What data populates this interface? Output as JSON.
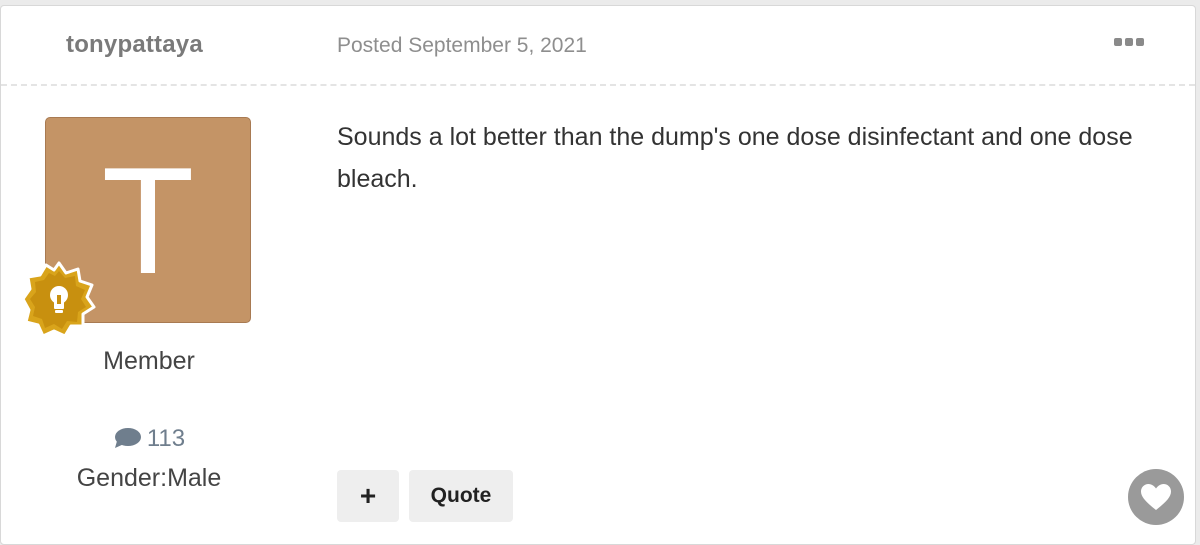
{
  "post": {
    "author": "tonypattaya",
    "posted": "Posted September 5, 2021",
    "avatar_letter": "T",
    "role": "Member",
    "post_count": "113",
    "gender": "Gender:Male",
    "content": "Sounds a lot better than the dump's one dose disinfectant and one dose bleach.",
    "actions": {
      "plus_label": "+",
      "quote_label": "Quote"
    }
  },
  "colors": {
    "avatar_bg": "#c49466",
    "badge_gold": "#d4a017",
    "author_text": "#7a7a7a",
    "like_bg": "#9a9a9a"
  },
  "icons": {
    "more": "ellipsis-icon",
    "badge": "lightbulb-badge-icon",
    "posts": "speech-bubble-icon",
    "like": "heart-icon"
  }
}
